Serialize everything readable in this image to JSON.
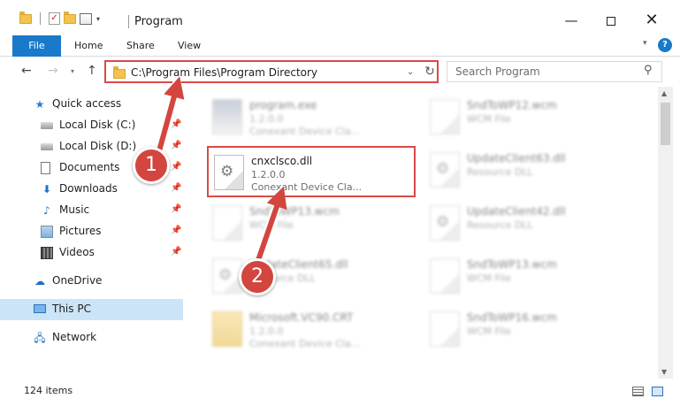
{
  "window": {
    "title": "Program",
    "minimize_glyph": "—",
    "close_glyph": "✕"
  },
  "ribbon": {
    "file": "File",
    "home": "Home",
    "share": "Share",
    "view": "View",
    "help": "?"
  },
  "address_bar": {
    "path": "C:\\Program Files\\Program Directory",
    "search_placeholder": "Search Program"
  },
  "sidebar": {
    "items": [
      {
        "label": "Quick access",
        "icon": "star-icon"
      },
      {
        "label": "Local Disk (C:)",
        "icon": "disk-icon",
        "pinned": true
      },
      {
        "label": "Local Disk (D:)",
        "icon": "disk-icon",
        "pinned": true
      },
      {
        "label": "Documents",
        "icon": "documents-icon",
        "pinned": true
      },
      {
        "label": "Downloads",
        "icon": "downloads-icon",
        "pinned": true
      },
      {
        "label": "Music",
        "icon": "music-icon",
        "pinned": true
      },
      {
        "label": "Pictures",
        "icon": "pictures-icon",
        "pinned": true
      },
      {
        "label": "Videos",
        "icon": "videos-icon",
        "pinned": true
      },
      {
        "label": "OneDrive",
        "icon": "onedrive-icon"
      },
      {
        "label": "This PC",
        "icon": "this-pc-icon",
        "selected": true
      },
      {
        "label": "Network",
        "icon": "network-icon"
      }
    ]
  },
  "files": [
    {
      "name": "program.exe",
      "line2": "1.2.0.0",
      "line3": "Conexant Device Cla..."
    },
    {
      "name": "SndToWP12.wcm",
      "line2": "WCM File",
      "line3": ""
    },
    {
      "name": "cnxclsco.dll",
      "line2": "1.2.0.0",
      "line3": "Conexant Device Cla..."
    },
    {
      "name": "UpdateClient63.dll",
      "line2": "Resource DLL",
      "line3": ""
    },
    {
      "name": "SndToWP13.wcm",
      "line2": "WCM File",
      "line3": ""
    },
    {
      "name": "UpdateClient42.dll",
      "line2": "Resource DLL",
      "line3": ""
    },
    {
      "name": "UpdateClient65.dll",
      "line2": "Resource DLL",
      "line3": ""
    },
    {
      "name": "SndToWP13.wcm",
      "line2": "WCM File",
      "line3": ""
    },
    {
      "name": "Microsoft.VC90.CRT",
      "line2": "1.2.0.0",
      "line3": "Conexant Device Cla..."
    },
    {
      "name": "SndToWP16.wcm",
      "line2": "WCM File",
      "line3": ""
    }
  ],
  "status": {
    "item_count": "124 items"
  },
  "annotations": {
    "step1": "1",
    "step2": "2"
  },
  "colors": {
    "accent": "#1979ca",
    "highlight_border": "#d94a48",
    "badge": "#d2463f",
    "arrow": "#d2463f",
    "selection": "#cce4f7"
  }
}
